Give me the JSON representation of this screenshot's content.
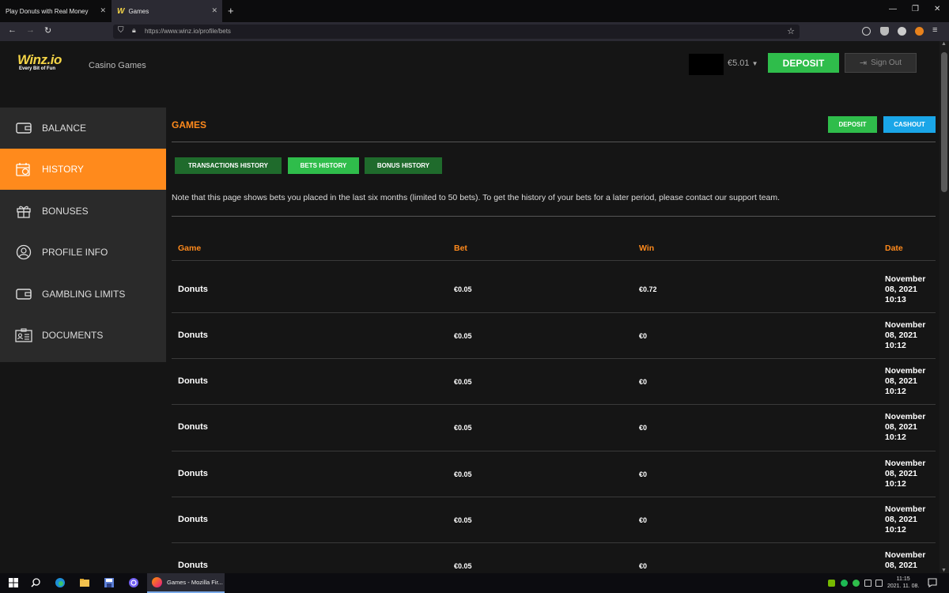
{
  "browser": {
    "tabs": [
      {
        "title": "Play Donuts with Real Money",
        "active": false
      },
      {
        "title": "Games",
        "active": true
      }
    ],
    "url": "https://www.winz.io/profile/bets"
  },
  "header": {
    "logo": "Winz.io",
    "tagline": "Every Bit of Fun",
    "nav_casino": "Casino Games",
    "balance": "€5.01",
    "deposit_label": "DEPOSIT",
    "signout_label": "Sign Out"
  },
  "sidebar": {
    "items": [
      {
        "label": "BALANCE",
        "icon": "wallet-icon",
        "active": false
      },
      {
        "label": "HISTORY",
        "icon": "history-icon",
        "active": true
      },
      {
        "label": "BONUSES",
        "icon": "gift-icon",
        "active": false
      },
      {
        "label": "PROFILE INFO",
        "icon": "user-icon",
        "active": false
      },
      {
        "label": "GAMBLING LIMITS",
        "icon": "wallet-limit-icon",
        "active": false
      },
      {
        "label": "DOCUMENTS",
        "icon": "id-card-icon",
        "active": false
      }
    ]
  },
  "main": {
    "title": "GAMES",
    "deposit_label": "DEPOSIT",
    "cashout_label": "CASHOUT",
    "tabs": [
      {
        "label": "TRANSACTIONS HISTORY",
        "active": false
      },
      {
        "label": "BETS HISTORY",
        "active": true
      },
      {
        "label": "BONUS HISTORY",
        "active": false
      }
    ],
    "note": "Note that this page shows bets you placed in the last six months (limited to 50 bets). To get the history of your bets for a later period, please contact our support team.",
    "table": {
      "headers": {
        "game": "Game",
        "bet": "Bet",
        "win": "Win",
        "date": "Date"
      },
      "rows": [
        {
          "game": "Donuts",
          "bet": "€0.05",
          "win": "€0.72",
          "date_l1": "November",
          "date_l2": "08, 2021",
          "date_l3": "10:13"
        },
        {
          "game": "Donuts",
          "bet": "€0.05",
          "win": "€0",
          "date_l1": "November",
          "date_l2": "08, 2021",
          "date_l3": "10:12"
        },
        {
          "game": "Donuts",
          "bet": "€0.05",
          "win": "€0",
          "date_l1": "November",
          "date_l2": "08, 2021",
          "date_l3": "10:12"
        },
        {
          "game": "Donuts",
          "bet": "€0.05",
          "win": "€0",
          "date_l1": "November",
          "date_l2": "08, 2021",
          "date_l3": "10:12"
        },
        {
          "game": "Donuts",
          "bet": "€0.05",
          "win": "€0",
          "date_l1": "November",
          "date_l2": "08, 2021",
          "date_l3": "10:12"
        },
        {
          "game": "Donuts",
          "bet": "€0.05",
          "win": "€0",
          "date_l1": "November",
          "date_l2": "08, 2021",
          "date_l3": "10:12"
        },
        {
          "game": "Donuts",
          "bet": "€0.05",
          "win": "€0",
          "date_l1": "November",
          "date_l2": "08, 2021",
          "date_l3": ""
        }
      ]
    }
  },
  "taskbar": {
    "firefox_label": "Games - Mozilla Fir...",
    "time": "11:15",
    "date": "2021. 11. 08."
  },
  "colors": {
    "accent_orange": "#ff8a1c",
    "green": "#2fbd4b",
    "blue": "#1aa6e8",
    "tab_green": "#1f6b2c"
  }
}
